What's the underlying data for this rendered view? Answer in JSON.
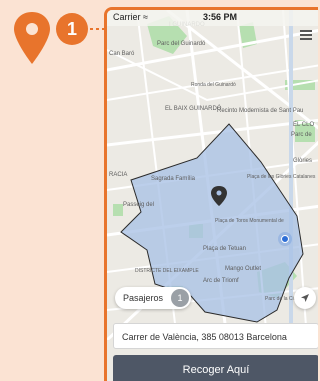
{
  "callout": {
    "step_number": "1",
    "icon": "location-pin-icon",
    "color": "#e8742c"
  },
  "status_bar": {
    "carrier": "Carrier ≈",
    "time": "3:56 PM"
  },
  "map": {
    "labels": [
      "I GUINARDO",
      "Parc del Guinardó",
      "Can Baró",
      "Ronda del Guinardó",
      "EL BAIX GUINARDÓ",
      "Recinto Modernista de Sant Pau",
      "Parc de",
      "Sagrada Família",
      "Plaça de les Glòries Catalanes",
      "Plaça de Toros Monumental de",
      "Plaça de Tetuan",
      "Mango Outlet",
      "Arc de Triomf",
      "DISTRICTE DEL EIXAMPLE",
      "Parc de la Ciutadella",
      "EL CLO",
      "Glòries",
      "RACIA",
      "Passeig del"
    ],
    "colors": {
      "zone_fill": "#a9c1e6",
      "zone_border": "#2a2a2a",
      "park": "#b6dfb0",
      "user_dot": "#2f6fd6"
    }
  },
  "menu": {
    "icon": "hamburger-menu-icon"
  },
  "passengers": {
    "label": "Pasajeros",
    "count": "1"
  },
  "location_button": {
    "icon": "navigation-arrow-icon"
  },
  "address": {
    "value": "Carrer de València, 385 08013 Barcelona"
  },
  "action": {
    "label": "Recoger Aquí"
  }
}
